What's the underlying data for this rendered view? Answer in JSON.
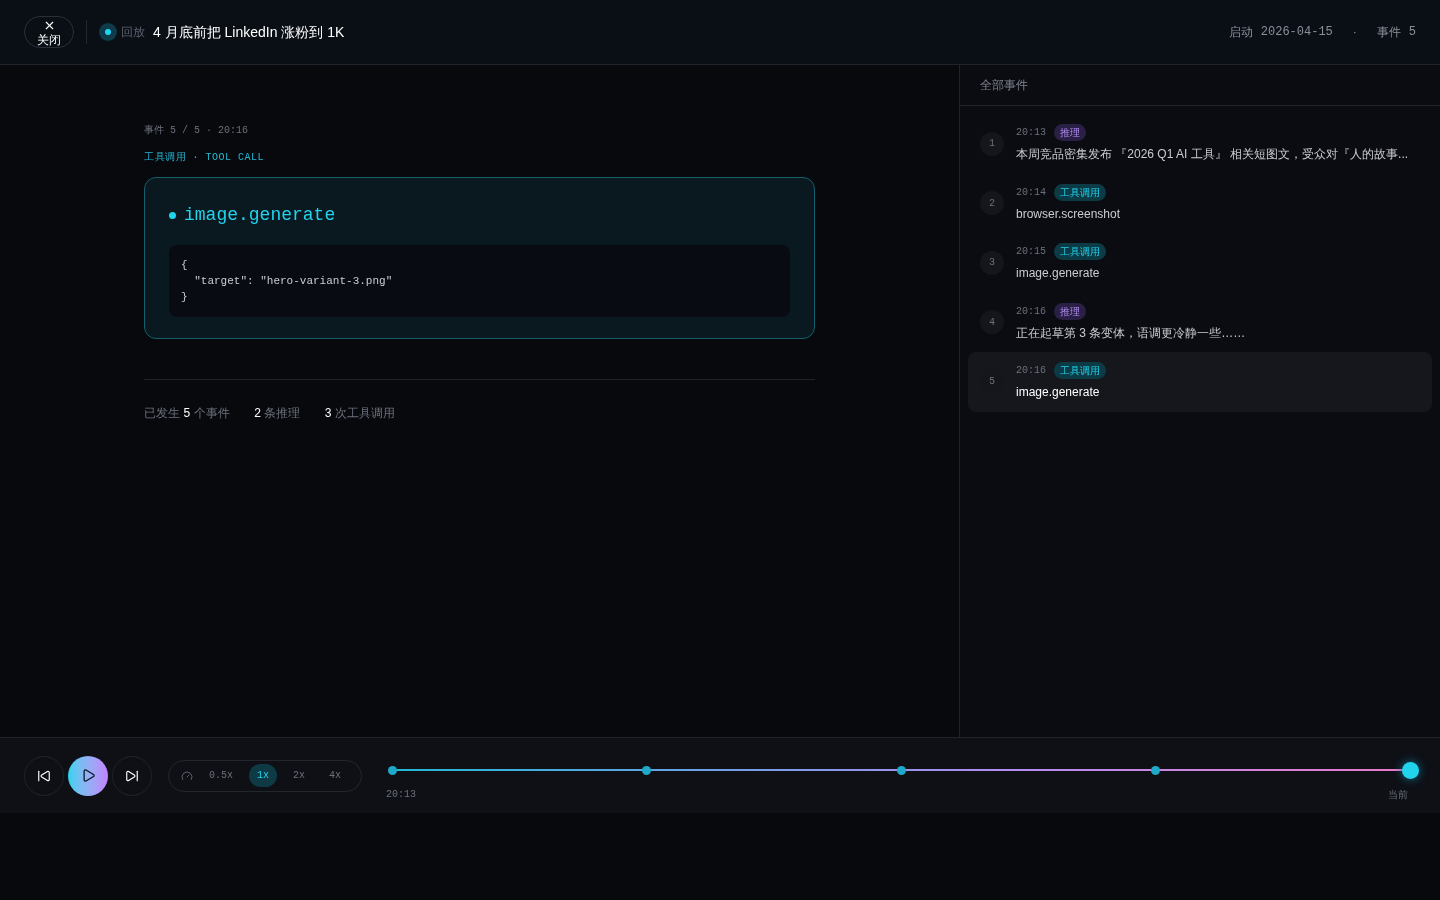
{
  "header": {
    "close_label": "关闭",
    "mode": "回放",
    "title": "4 月底前把 LinkedIn 涨粉到 1K",
    "start_label": "启动",
    "start_date": "2026-04-15",
    "separator": "·",
    "events_label": "事件",
    "events_count": "5"
  },
  "detail": {
    "meta": "事件 5 / 5 · 20:16",
    "type_label": "工具调用 · TOOL CALL",
    "tool_name": "image.generate",
    "code_lines": [
      "{",
      "  \"target\": \"hero-variant-3.png\"",
      "}"
    ],
    "stats": [
      {
        "prefix": "已发生",
        "count": "5",
        "label": "个事件"
      },
      {
        "count": "2",
        "label": "条推理"
      },
      {
        "count": "3",
        "label": "次工具调用"
      }
    ]
  },
  "events_panel": {
    "title": "全部事件",
    "events": [
      {
        "index": "1",
        "time": "20:13",
        "kind": "reasoning",
        "tag": "推理",
        "text": "本周竞品密集发布 『2026 Q1 AI 工具』 相关短图文，受众对『人的故事...",
        "selected": false
      },
      {
        "index": "2",
        "time": "20:14",
        "kind": "tool",
        "tag": "工具调用",
        "text": "browser.screenshot",
        "selected": false
      },
      {
        "index": "3",
        "time": "20:15",
        "kind": "tool",
        "tag": "工具调用",
        "text": "image.generate",
        "selected": false
      },
      {
        "index": "4",
        "time": "20:16",
        "kind": "reasoning",
        "tag": "推理",
        "text": "正在起草第 3 条变体，语调更冷静一些……",
        "selected": false
      },
      {
        "index": "5",
        "time": "20:16",
        "kind": "tool",
        "tag": "工具调用",
        "text": "image.generate",
        "selected": true
      }
    ]
  },
  "player": {
    "speeds": [
      {
        "label": "0.5x",
        "selected": false
      },
      {
        "label": "1x",
        "selected": true
      },
      {
        "label": "2x",
        "selected": false
      },
      {
        "label": "4x",
        "selected": false
      }
    ],
    "timeline": {
      "level": 1,
      "start_label": "20:13",
      "end_label": "当前"
    }
  }
}
